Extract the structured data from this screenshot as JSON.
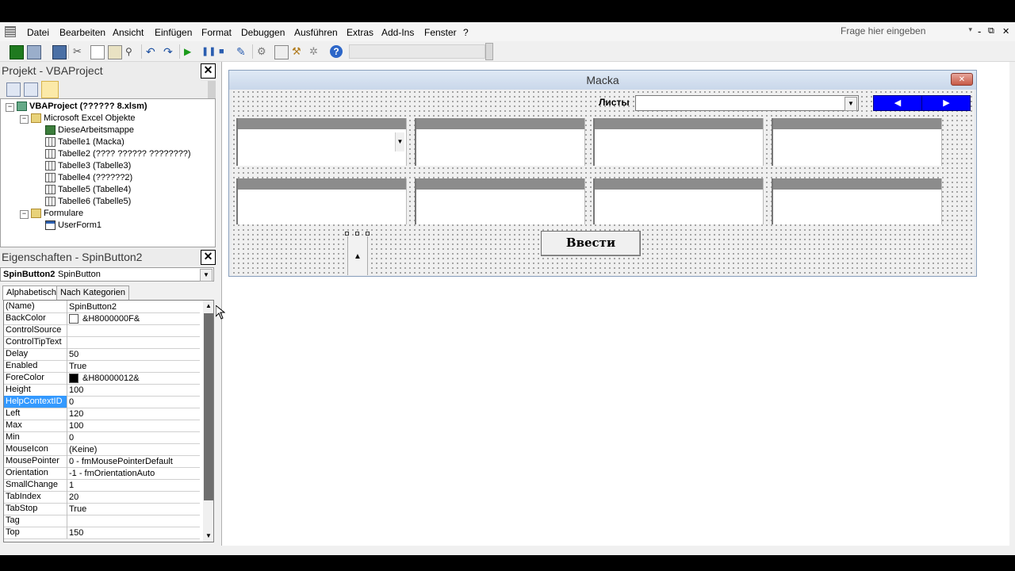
{
  "menu": [
    "Datei",
    "Bearbeiten",
    "Ansicht",
    "Einfügen",
    "Format",
    "Debuggen",
    "Ausführen",
    "Extras",
    "Add-Ins",
    "Fenster",
    "?"
  ],
  "help_search": "Frage hier eingeben",
  "window_controls": [
    "-",
    "⧉",
    "✕"
  ],
  "project_pane": {
    "title": "Projekt - VBAProject",
    "tree": [
      {
        "label": "VBAProject (?????? 8.xlsm)",
        "icon": "project-icon"
      },
      {
        "label": "Microsoft Excel Objekte",
        "icon": "folder-icon"
      },
      {
        "label": "DieseArbeitsmappe",
        "icon": "workbook-icon"
      },
      {
        "label": "Tabelle1 (Macka)",
        "icon": "sheet-icon"
      },
      {
        "label": "Tabelle2 (???? ?????? ????????)",
        "icon": "sheet-icon"
      },
      {
        "label": "Tabelle3 (Tabelle3)",
        "icon": "sheet-icon"
      },
      {
        "label": "Tabelle4 (??????2)",
        "icon": "sheet-icon"
      },
      {
        "label": "Tabelle5 (Tabelle4)",
        "icon": "sheet-icon"
      },
      {
        "label": "Tabelle6 (Tabelle5)",
        "icon": "sheet-icon"
      },
      {
        "label": "Formulare",
        "icon": "folder-icon"
      },
      {
        "label": "UserForm1",
        "icon": "form-icon"
      }
    ]
  },
  "properties_pane": {
    "title": "Eigenschaften - SpinButton2",
    "object_name": "SpinButton2",
    "object_type": "SpinButton",
    "tabs": [
      "Alphabetisch",
      "Nach Kategorien"
    ],
    "selected_property": "HelpContextID",
    "rows": [
      {
        "name": "(Name)",
        "value": "SpinButton2"
      },
      {
        "name": "BackColor",
        "value": "&H8000000F&",
        "swatch": "#ffffff"
      },
      {
        "name": "ControlSource",
        "value": ""
      },
      {
        "name": "ControlTipText",
        "value": ""
      },
      {
        "name": "Delay",
        "value": "50"
      },
      {
        "name": "Enabled",
        "value": "True"
      },
      {
        "name": "ForeColor",
        "value": "&H80000012&",
        "swatch": "#000000"
      },
      {
        "name": "Height",
        "value": "100"
      },
      {
        "name": "HelpContextID",
        "value": "0"
      },
      {
        "name": "Left",
        "value": "120"
      },
      {
        "name": "Max",
        "value": "100"
      },
      {
        "name": "Min",
        "value": "0"
      },
      {
        "name": "MouseIcon",
        "value": "(Keine)"
      },
      {
        "name": "MousePointer",
        "value": "0 - fmMousePointerDefault"
      },
      {
        "name": "Orientation",
        "value": "-1 - fmOrientationAuto"
      },
      {
        "name": "SmallChange",
        "value": "1"
      },
      {
        "name": "TabIndex",
        "value": "20"
      },
      {
        "name": "TabStop",
        "value": "True"
      },
      {
        "name": "Tag",
        "value": ""
      },
      {
        "name": "Top",
        "value": "150"
      }
    ]
  },
  "userform": {
    "caption": "Macka",
    "sheets_label": "Листы",
    "submit_label": "Ввести",
    "nav_prev": "◀",
    "nav_next": "▶",
    "accent": "#0000ff"
  }
}
